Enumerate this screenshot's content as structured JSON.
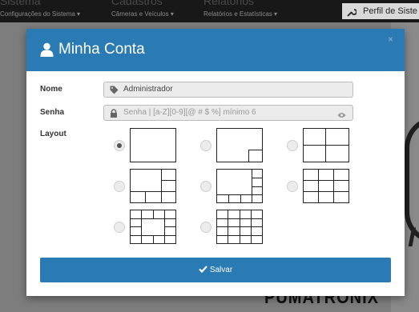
{
  "topbar": {
    "menus": [
      {
        "title": "Sistema",
        "label": "Configurações do Sistema ▾"
      },
      {
        "title": "Cadastros",
        "label": "Câmeras e Veículos ▾"
      },
      {
        "title": "Relatórios",
        "label": "Relatórios e Estatísticas ▾"
      }
    ],
    "profile_label": "Perfil de Siste"
  },
  "background": {
    "brand": "PUMATRONIX"
  },
  "modal": {
    "title": "Minha Conta",
    "close": "×",
    "name_label": "Nome",
    "name_value": "Administrador",
    "password_label": "Senha",
    "password_placeholder": "Senha | [a-Z][0-9][@ # $ %] mínimo 6",
    "layout_label": "Layout",
    "layout_options": [
      "1",
      "1+1 pip",
      "4",
      "6",
      "8",
      "9",
      "13",
      "16"
    ],
    "selected_layout": "1",
    "save_label": "Salvar"
  },
  "colors": {
    "primary": "#2a7ab3",
    "topbar": "#181818"
  }
}
